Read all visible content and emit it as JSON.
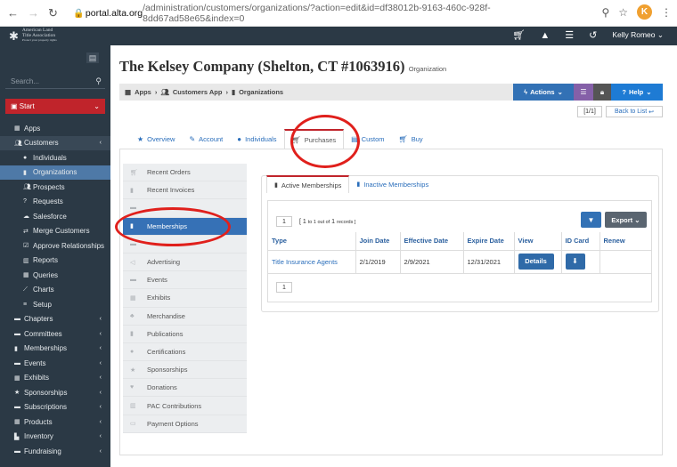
{
  "browser": {
    "url_host": "portal.alta.org",
    "url_path": "/administration/customers/organizations/?action=edit&id=df38012b-9163-460c-928f-8dd67ad58e65&index=0",
    "avatar_letter": "K"
  },
  "topbar": {
    "logo_line1": "American Land",
    "logo_line2": "Title Association",
    "logo_line3": "Protect your property rights",
    "user_name": "Kelly Romeo"
  },
  "sidebar": {
    "search_placeholder": "Search...",
    "start_label": "Start",
    "items": [
      {
        "label": "Apps",
        "icon": "apps-icon"
      },
      {
        "label": "Customers",
        "icon": "users-icon"
      },
      {
        "label": "Individuals",
        "icon": "user-icon"
      },
      {
        "label": "Organizations",
        "icon": "building-icon"
      },
      {
        "label": "Prospects",
        "icon": "prospects-icon"
      },
      {
        "label": "Requests",
        "icon": "question-icon"
      },
      {
        "label": "Salesforce",
        "icon": "cloud-icon"
      },
      {
        "label": "Merge Customers",
        "icon": "merge-icon"
      },
      {
        "label": "Approve Relationships",
        "icon": "check-icon"
      },
      {
        "label": "Reports",
        "icon": "chart-icon"
      },
      {
        "label": "Queries",
        "icon": "table-icon"
      },
      {
        "label": "Charts",
        "icon": "line-chart-icon"
      },
      {
        "label": "Setup",
        "icon": "list-icon"
      },
      {
        "label": "Chapters",
        "icon": "chapters-icon"
      },
      {
        "label": "Committees",
        "icon": "committees-icon"
      },
      {
        "label": "Memberships",
        "icon": "bookmark-icon"
      },
      {
        "label": "Events",
        "icon": "events-icon"
      },
      {
        "label": "Exhibits",
        "icon": "exhibits-icon"
      },
      {
        "label": "Sponsorships",
        "icon": "star-icon"
      },
      {
        "label": "Subscriptions",
        "icon": "subscriptions-icon"
      },
      {
        "label": "Products",
        "icon": "products-icon"
      },
      {
        "label": "Inventory",
        "icon": "inventory-icon"
      },
      {
        "label": "Fundraising",
        "icon": "fundraising-icon"
      }
    ]
  },
  "header": {
    "title": "The Kelsey Company (Shelton, CT #1063916)",
    "subtitle": "Organization",
    "breadcrumb": [
      "Apps",
      "Customers App",
      "Organizations"
    ],
    "actions_label": "Actions",
    "help_label": "Help",
    "pager_text": "[1/1]",
    "back_label": "Back to List"
  },
  "tabs": [
    {
      "label": "Overview"
    },
    {
      "label": "Account"
    },
    {
      "label": "Individuals"
    },
    {
      "label": "Purchases"
    },
    {
      "label": "Custom"
    },
    {
      "label": "Buy"
    }
  ],
  "left_nav": [
    "Recent Orders",
    "Recent Invoices",
    "",
    "Memberships",
    "",
    "Advertising",
    "Events",
    "Exhibits",
    "Merchandise",
    "Publications",
    "Certifications",
    "Sponsorships",
    "Donations",
    "PAC Contributions",
    "Payment Options"
  ],
  "membership_tabs": {
    "active": "Active Memberships",
    "inactive": "Inactive Memberships"
  },
  "grid": {
    "page": "1",
    "records_prefix": "[ 1",
    "records_small": "to 1 out of",
    "records_suffix": "1",
    "records_word": "records ]",
    "export_label": "Export",
    "columns": [
      "Type",
      "Join Date",
      "Effective Date",
      "Expire Date",
      "View",
      "ID Card",
      "Renew"
    ],
    "rows": [
      {
        "type": "Title Insurance Agents",
        "join": "2/1/2019",
        "effective": "2/9/2021",
        "expire": "12/31/2021",
        "view": "Details"
      }
    ]
  },
  "colors": {
    "sidebar_bg": "#2b3945",
    "accent_red": "#c0242b",
    "primary_blue": "#3271b5",
    "annotation_red": "#e0201c"
  }
}
